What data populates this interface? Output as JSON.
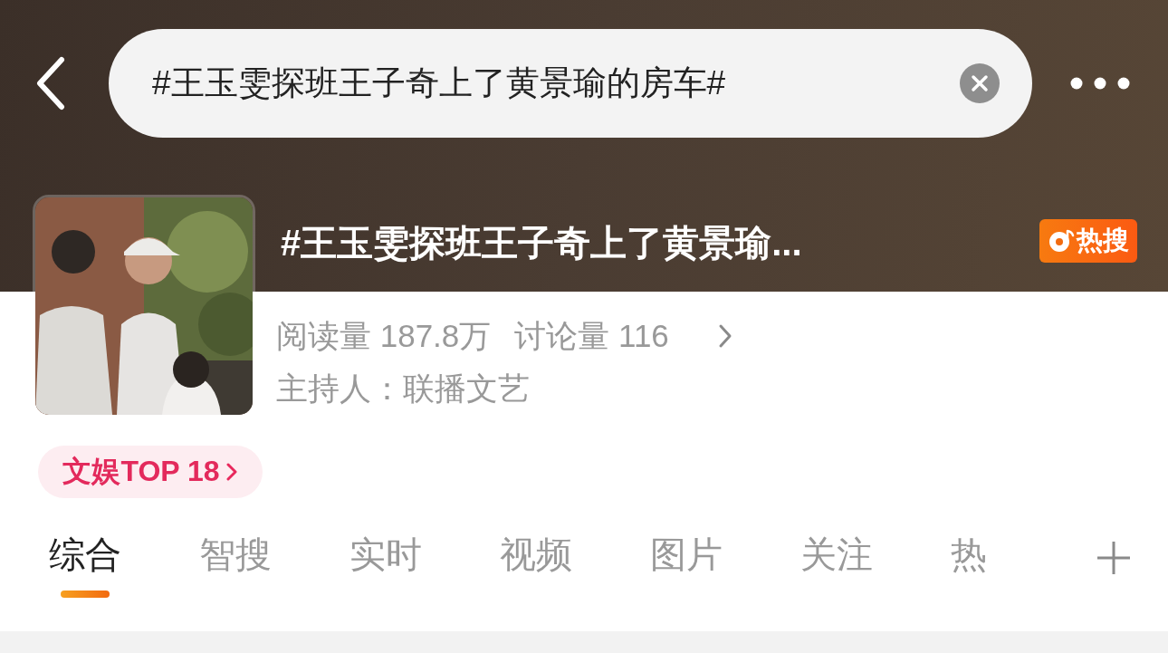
{
  "search": {
    "value": "#王玉雯探班王子奇上了黄景瑜的房车#"
  },
  "topic": {
    "title": "#王玉雯探班王子奇上了黄景瑜...",
    "badge": "热搜",
    "reads_label": "阅读量",
    "reads": "187.8万",
    "discussions_label": "讨论量",
    "discussions": "116",
    "host": "主持人：联播文艺",
    "rank_chip": "文娱TOP 18"
  },
  "tabs": [
    {
      "label": "综合",
      "selected": true
    },
    {
      "label": "智搜",
      "selected": false
    },
    {
      "label": "实时",
      "selected": false
    },
    {
      "label": "视频",
      "selected": false
    },
    {
      "label": "图片",
      "selected": false
    },
    {
      "label": "关注",
      "selected": false
    },
    {
      "label": "热",
      "selected": false
    }
  ]
}
